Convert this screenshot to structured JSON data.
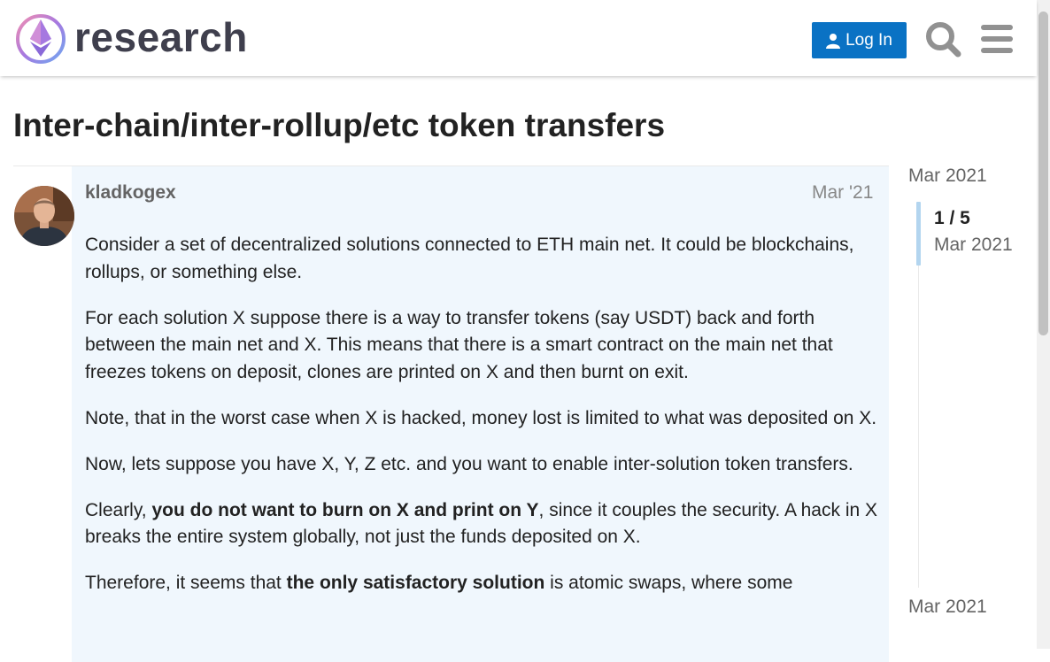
{
  "header": {
    "site_name": "research",
    "login_label": "Log In"
  },
  "topic": {
    "title": "Inter-chain/inter-rollup/etc token transfers"
  },
  "post": {
    "username": "kladkogex",
    "date": "Mar '21",
    "paragraphs": [
      {
        "segments": [
          {
            "text": "Consider a set of decentralized solutions connected to ETH main net. It could be blockchains, rollups, or something else.",
            "bold": false
          }
        ]
      },
      {
        "segments": [
          {
            "text": "For each solution X suppose there is a way to transfer tokens (say USDT) back and forth between the main net and X. This means that there is a smart contract on the main net that freezes tokens on deposit, clones are printed on X and then burnt on exit.",
            "bold": false
          }
        ]
      },
      {
        "segments": [
          {
            "text": "Note, that in the worst case when X is hacked, money lost is limited to what was deposited on X.",
            "bold": false
          }
        ]
      },
      {
        "segments": [
          {
            "text": "Now, lets suppose you have X, Y, Z etc. and you want to enable inter-solution token transfers.",
            "bold": false
          }
        ]
      },
      {
        "segments": [
          {
            "text": "Clearly, ",
            "bold": false
          },
          {
            "text": "you do not want to burn on X and print on Y",
            "bold": true
          },
          {
            "text": ", since it couples the security. A hack in X breaks the entire system globally, not just the funds deposited on X.",
            "bold": false
          }
        ]
      },
      {
        "segments": [
          {
            "text": "Therefore, it seems that ",
            "bold": false
          },
          {
            "text": "the only satisfactory solution",
            "bold": true
          },
          {
            "text": " is atomic swaps, where some",
            "bold": false
          }
        ]
      }
    ]
  },
  "timeline": {
    "start_date": "Mar 2021",
    "position": "1 / 5",
    "position_date": "Mar 2021",
    "end_date": "Mar 2021"
  },
  "colors": {
    "accent": "#0a72c4",
    "post_background": "#f0f7fd",
    "timeline_handle": "#b3d5ef"
  },
  "icons": [
    "ethereum-logo-icon",
    "user-icon",
    "search-icon",
    "hamburger-menu-icon"
  ]
}
